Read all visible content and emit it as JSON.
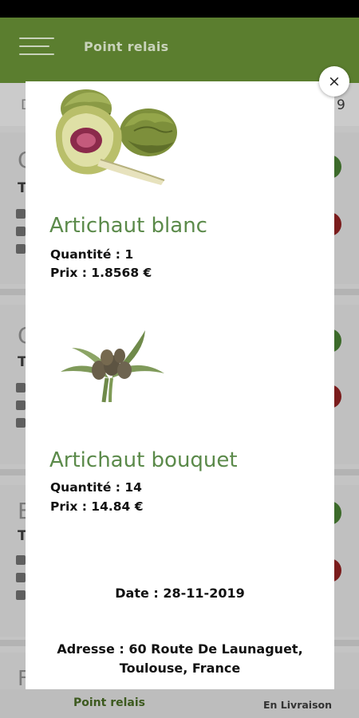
{
  "app_bar": {
    "title": "Point relais"
  },
  "background": {
    "header_left": "D",
    "header_right": "9",
    "card_letters": [
      "C",
      "C",
      "E",
      "F"
    ],
    "card_subletters": [
      "T",
      "T",
      "T"
    ]
  },
  "modal": {
    "products": [
      {
        "name": "Artichaut blanc",
        "quantity": "Quantité : 1",
        "price": "Prix : 1.8568 €",
        "image": "artichoke-halved-icon"
      },
      {
        "name": "Artichaut bouquet",
        "quantity": "Quantité : 14",
        "price": "Prix : 14.84 €",
        "image": "artichoke-bouquet-icon"
      }
    ],
    "date": "Date : 28-11-2019",
    "address_line1": "Adresse : 60 Route De Launaguet,",
    "address_line2": "Toulouse, France",
    "close_label": "×"
  },
  "bottom_nav": {
    "point_relais": "Point relais",
    "en_livraison": "En Livraison"
  },
  "colors": {
    "app_bar": "#5b7e2f",
    "product_name": "#5b8a4a"
  }
}
